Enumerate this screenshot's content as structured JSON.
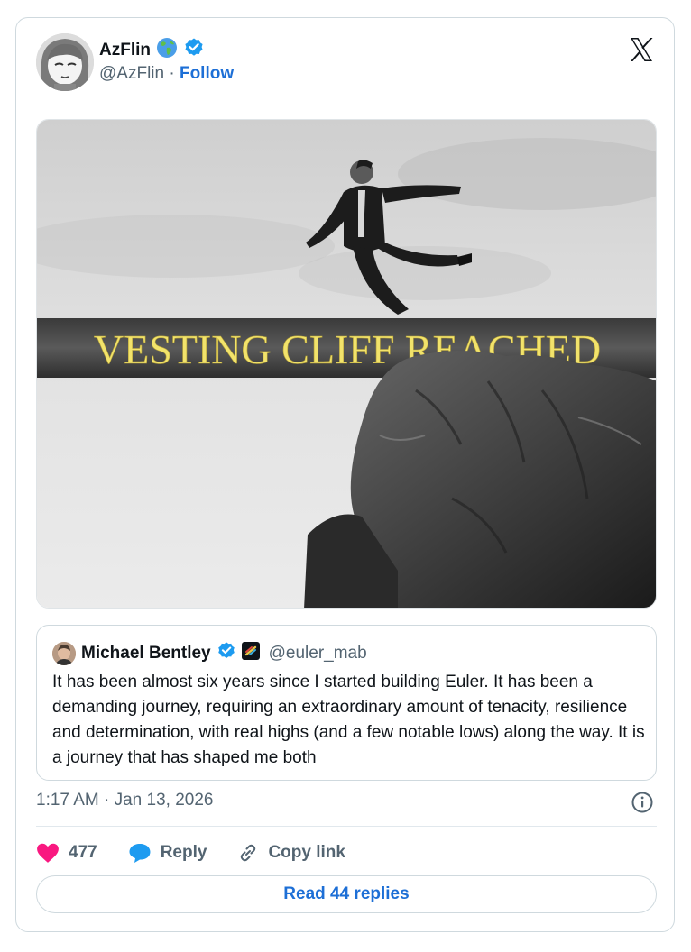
{
  "author": {
    "name": "AzFlin",
    "handle": "@AzFlin",
    "separator": "·",
    "follow_label": "Follow",
    "globe_icon": "globe-icon",
    "verified_icon": "verified-badge-icon"
  },
  "media": {
    "banner_text": "VESTING CLIFF REACHED"
  },
  "quoted_tweet": {
    "name": "Michael Bentley",
    "handle": "@euler_mab",
    "text": "It has been almost six years since I started building Euler. It has been a demanding journey, requiring an extraordinary amount of tenacity, resilience and determination, with real highs (and a few notable lows) along the way. It is a journey that has shaped me both"
  },
  "meta": {
    "timestamp": "1:17 AM · Jan 13, 2026"
  },
  "actions": {
    "like_count": "477",
    "reply_label": "Reply",
    "copy_link_label": "Copy link",
    "read_replies_label": "Read 44 replies"
  },
  "colors": {
    "link_blue": "#1d6fd6",
    "verified_blue": "#1d9bf0",
    "like_pink": "#f91880",
    "banner_yellow": "#f2e36b"
  }
}
